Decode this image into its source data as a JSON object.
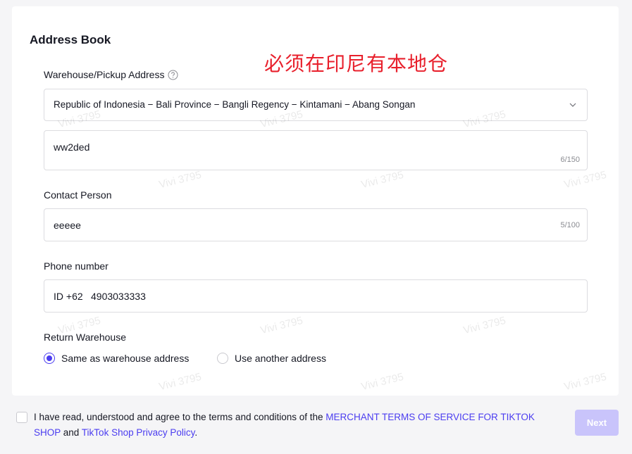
{
  "address_book": {
    "title": "Address Book",
    "annotation": "必须在印尼有本地仓"
  },
  "warehouse": {
    "label": "Warehouse/Pickup Address",
    "region_value": "Republic of Indonesia − Bali Province − Bangli Regency − Kintamani − Abang Songan",
    "detail_value": "ww2ded",
    "detail_counter": "6/150"
  },
  "contact": {
    "label": "Contact Person",
    "value": "eeeee",
    "counter": "5/100"
  },
  "phone": {
    "label": "Phone number",
    "country_code": "ID +62",
    "value": "4903033333"
  },
  "return_warehouse": {
    "label": "Return Warehouse",
    "options": [
      {
        "label": "Same as warehouse address",
        "checked": true
      },
      {
        "label": "Use another address",
        "checked": false
      }
    ]
  },
  "terms": {
    "prefix": "I have read, understood and agree to the terms and conditions of the ",
    "link1": "MERCHANT TERMS OF SERVICE FOR TIKTOK SHOP",
    "middle": " and ",
    "link2": "TikTok Shop Privacy Policy",
    "suffix": "."
  },
  "next_label": "Next",
  "watermark_text": "Vivi 3795",
  "colors": {
    "accent": "#4b3df0",
    "annotation": "#e8202c",
    "button_disabled": "#c9c4fb"
  }
}
